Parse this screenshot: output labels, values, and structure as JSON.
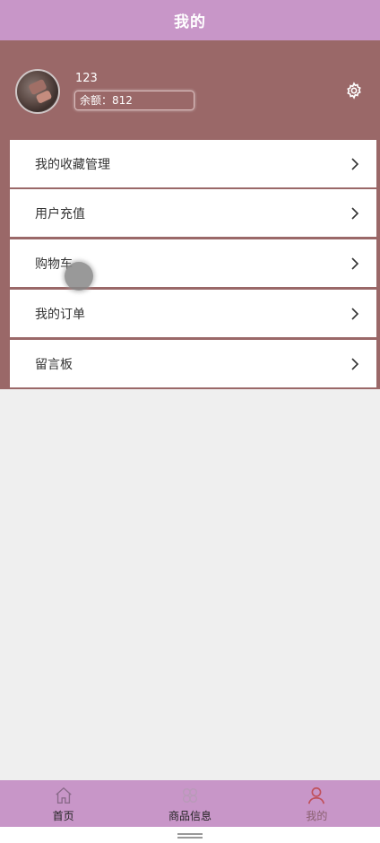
{
  "header": {
    "title": "我的"
  },
  "profile": {
    "username": "123",
    "balance_label": "余额：",
    "balance_value": "812"
  },
  "menu": {
    "items": [
      {
        "label": "我的收藏管理"
      },
      {
        "label": "用户充值"
      },
      {
        "label": "购物车"
      },
      {
        "label": "我的订单"
      },
      {
        "label": "留言板"
      }
    ]
  },
  "tabbar": {
    "tabs": [
      {
        "label": "首页",
        "icon": "home-icon"
      },
      {
        "label": "商品信息",
        "icon": "clover-icon"
      },
      {
        "label": "我的",
        "icon": "user-icon",
        "active": true
      }
    ]
  },
  "colors": {
    "header": "#c896c8",
    "profile_bg": "#9a6868",
    "active_tab": "#c0505a"
  }
}
